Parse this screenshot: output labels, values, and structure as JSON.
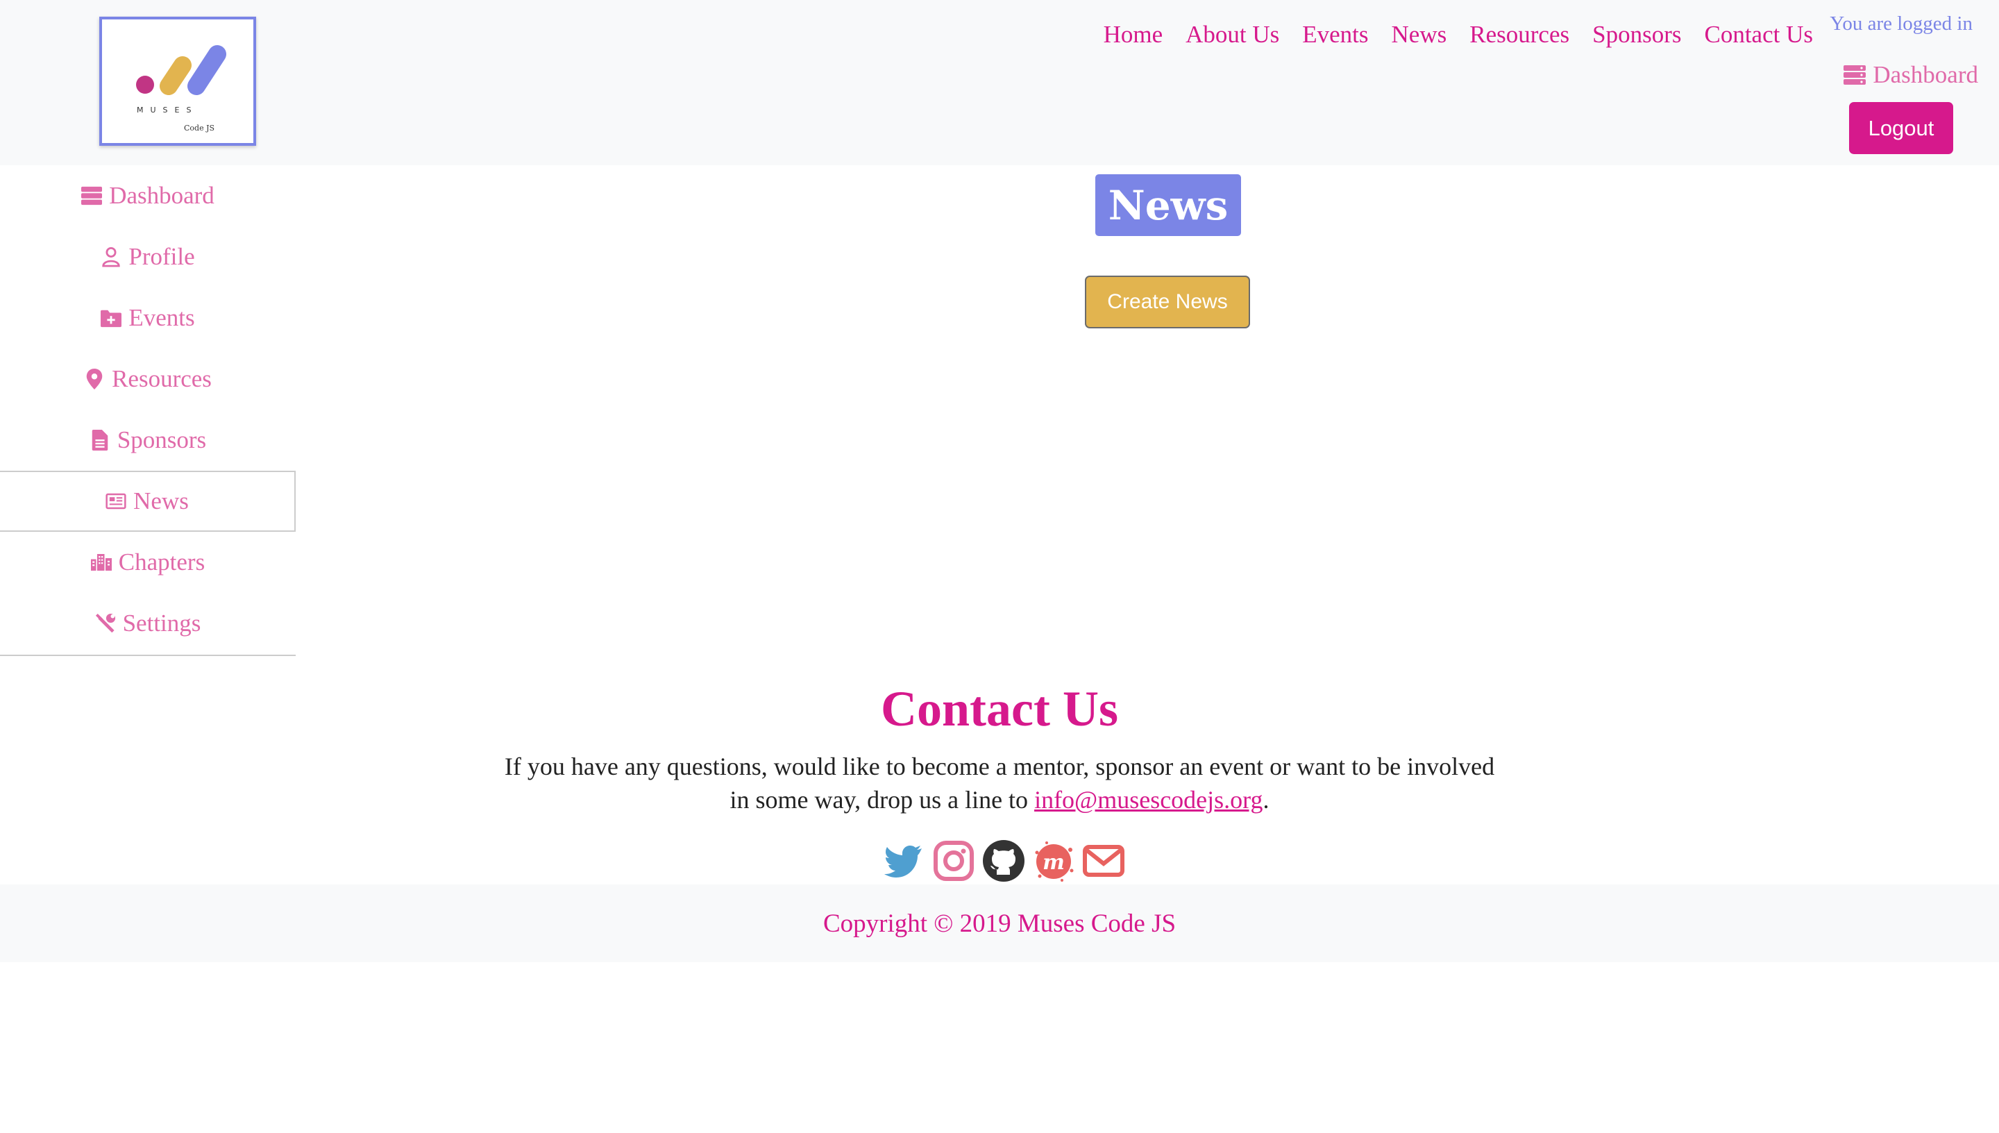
{
  "brand": {
    "logo_text": "MUSES",
    "logo_subtext": "Code JS"
  },
  "topnav": [
    {
      "label": "Home"
    },
    {
      "label": "About Us"
    },
    {
      "label": "Events"
    },
    {
      "label": "News"
    },
    {
      "label": "Resources"
    },
    {
      "label": "Sponsors"
    },
    {
      "label": "Contact Us"
    }
  ],
  "user": {
    "status_text": "You are logged in",
    "dashboard_label": "Dashboard",
    "logout_label": "Logout"
  },
  "sidebar": {
    "items": [
      {
        "label": "Dashboard",
        "icon": "server-icon"
      },
      {
        "label": "Profile",
        "icon": "user-icon"
      },
      {
        "label": "Events",
        "icon": "folder-plus-icon"
      },
      {
        "label": "Resources",
        "icon": "map-marker-icon"
      },
      {
        "label": "Sponsors",
        "icon": "file-icon"
      },
      {
        "label": "News",
        "icon": "newspaper-icon",
        "active": true
      },
      {
        "label": "Chapters",
        "icon": "city-icon"
      },
      {
        "label": "Settings",
        "icon": "tools-icon"
      }
    ]
  },
  "main": {
    "title": "News",
    "create_button_label": "Create News"
  },
  "contact": {
    "title": "Contact Us",
    "text_before": "If you have any questions, would like to become a mentor, sponsor an event or want to be involved in some way, drop us a line to ",
    "email": "info@musescodejs.org",
    "text_after": ".",
    "social": [
      "twitter-icon",
      "instagram-icon",
      "github-icon",
      "meetup-icon",
      "envelope-icon"
    ]
  },
  "footer": {
    "copyright": "Copyright © 2019 Muses Code JS"
  },
  "colors": {
    "brand_pink": "#d6198c",
    "light_pink": "#e06aa9",
    "periwinkle": "#7b85e6",
    "gold": "#e2b44f",
    "footer_bg": "#f8f9fa"
  }
}
